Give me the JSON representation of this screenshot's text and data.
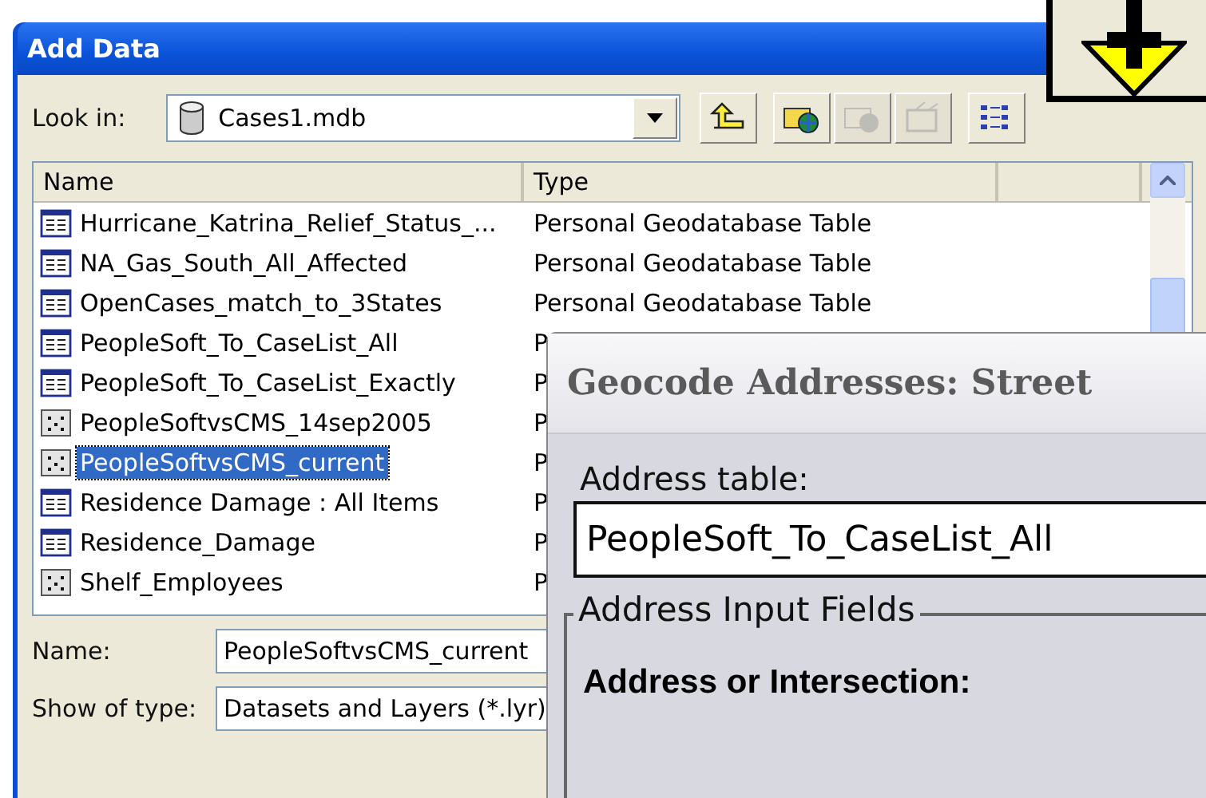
{
  "add_data": {
    "title": "Add Data",
    "look_in": {
      "label": "Look in:",
      "value": "Cases1.mdb"
    },
    "toolbar": [
      {
        "kind": "up",
        "disabled": false
      },
      {
        "kind": "connect",
        "disabled": false
      },
      {
        "kind": "disconnect",
        "disabled": true
      },
      {
        "kind": "properties",
        "disabled": true
      },
      {
        "kind": "list",
        "disabled": false
      }
    ],
    "columns": [
      "Name",
      "Type"
    ],
    "rows": [
      {
        "name": "Hurricane_Katrina_Relief_Status_...",
        "type": "Personal Geodatabase Table",
        "kind": "table",
        "selected": false
      },
      {
        "name": "NA_Gas_South_All_Affected",
        "type": "Personal Geodatabase Table",
        "kind": "table",
        "selected": false
      },
      {
        "name": "OpenCases_match_to_3States",
        "type": "Personal Geodatabase Table",
        "kind": "table",
        "selected": false
      },
      {
        "name": "PeopleSoft_To_CaseList_All",
        "type": "P",
        "kind": "table",
        "selected": false
      },
      {
        "name": "PeopleSoft_To_CaseList_Exactly",
        "type": "P",
        "kind": "table",
        "selected": false
      },
      {
        "name": "PeopleSoftvsCMS_14sep2005",
        "type": "P",
        "kind": "points",
        "selected": false
      },
      {
        "name": "PeopleSoftvsCMS_current",
        "type": "P",
        "kind": "points",
        "selected": true
      },
      {
        "name": "Residence Damage : All Items",
        "type": "P",
        "kind": "table",
        "selected": false
      },
      {
        "name": "Residence_Damage",
        "type": "P",
        "kind": "table",
        "selected": false
      },
      {
        "name": "Shelf_Employees",
        "type": "P",
        "kind": "points",
        "selected": false
      }
    ],
    "name_field": {
      "label": "Name:",
      "value": "PeopleSoftvsCMS_current"
    },
    "type_field": {
      "label": "Show of type:",
      "value": "Datasets and Layers (*.lyr)"
    }
  },
  "geocode": {
    "title": "Geocode Addresses:  Street",
    "address_table": {
      "label": "Address table:",
      "value": "PeopleSoft_To_CaseList_All"
    },
    "group": {
      "legend": "Address Input Fields",
      "heading": "Address or Intersection:"
    }
  }
}
